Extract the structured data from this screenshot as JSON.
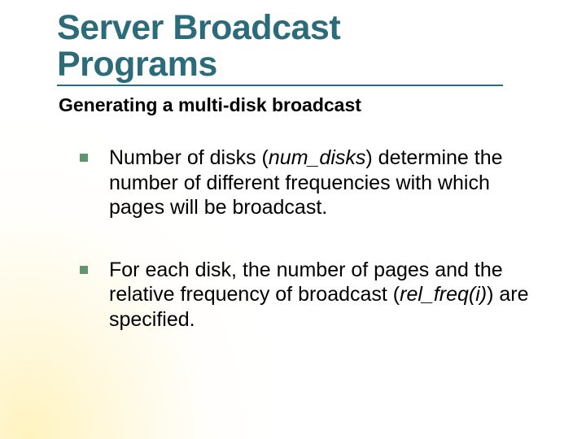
{
  "title": {
    "line1": "Server Broadcast",
    "line2": "Programs"
  },
  "subtitle": "Generating a multi-disk broadcast",
  "bullets": [
    {
      "pre": "Number of disks (",
      "em": "num_disks",
      "post": ") determine the number of different frequencies with which pages will be broadcast."
    },
    {
      "pre": "For each disk, the number of pages and the relative frequency of broadcast (",
      "em": "rel_freq(i)",
      "post": ") are specified."
    }
  ]
}
